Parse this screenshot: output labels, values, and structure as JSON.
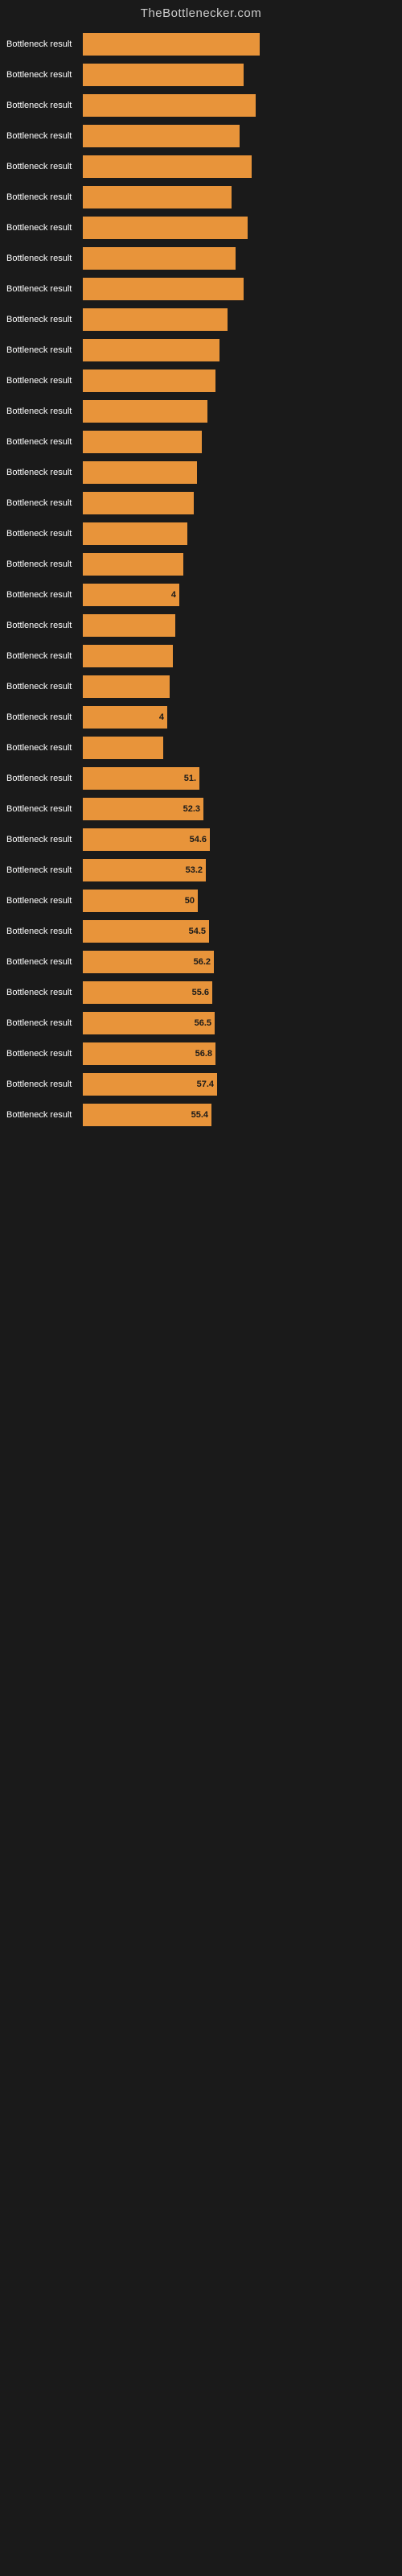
{
  "header": {
    "title": "TheBottlenecker.com"
  },
  "rows": [
    {
      "label": "Bottleneck result",
      "value": "",
      "barWidth": 220
    },
    {
      "label": "Bottleneck result",
      "value": "",
      "barWidth": 200
    },
    {
      "label": "Bottleneck result",
      "value": "",
      "barWidth": 215
    },
    {
      "label": "Bottleneck result",
      "value": "",
      "barWidth": 195
    },
    {
      "label": "Bottleneck result",
      "value": "",
      "barWidth": 210
    },
    {
      "label": "Bottleneck result",
      "value": "",
      "barWidth": 185
    },
    {
      "label": "Bottleneck result",
      "value": "",
      "barWidth": 205
    },
    {
      "label": "Bottleneck result",
      "value": "",
      "barWidth": 190
    },
    {
      "label": "Bottleneck result",
      "value": "",
      "barWidth": 200
    },
    {
      "label": "Bottleneck result",
      "value": "",
      "barWidth": 180
    },
    {
      "label": "Bottleneck result",
      "value": "",
      "barWidth": 170
    },
    {
      "label": "Bottleneck result",
      "value": "",
      "barWidth": 165
    },
    {
      "label": "Bottleneck result",
      "value": "",
      "barWidth": 155
    },
    {
      "label": "Bottleneck result",
      "value": "",
      "barWidth": 148
    },
    {
      "label": "Bottleneck result",
      "value": "",
      "barWidth": 142
    },
    {
      "label": "Bottleneck result",
      "value": "",
      "barWidth": 138
    },
    {
      "label": "Bottleneck result",
      "value": "",
      "barWidth": 130
    },
    {
      "label": "Bottleneck result",
      "value": "",
      "barWidth": 125
    },
    {
      "label": "Bottleneck result",
      "value": "4",
      "barWidth": 120
    },
    {
      "label": "Bottleneck result",
      "value": "",
      "barWidth": 115
    },
    {
      "label": "Bottleneck result",
      "value": "",
      "barWidth": 112
    },
    {
      "label": "Bottleneck result",
      "value": "",
      "barWidth": 108
    },
    {
      "label": "Bottleneck result",
      "value": "4",
      "barWidth": 105
    },
    {
      "label": "Bottleneck result",
      "value": "",
      "barWidth": 100
    },
    {
      "label": "Bottleneck result",
      "value": "51.",
      "barWidth": 145
    },
    {
      "label": "Bottleneck result",
      "value": "52.3",
      "barWidth": 150
    },
    {
      "label": "Bottleneck result",
      "value": "54.6",
      "barWidth": 158
    },
    {
      "label": "Bottleneck result",
      "value": "53.2",
      "barWidth": 153
    },
    {
      "label": "Bottleneck result",
      "value": "50",
      "barWidth": 143
    },
    {
      "label": "Bottleneck result",
      "value": "54.5",
      "barWidth": 157
    },
    {
      "label": "Bottleneck result",
      "value": "56.2",
      "barWidth": 163
    },
    {
      "label": "Bottleneck result",
      "value": "55.6",
      "barWidth": 161
    },
    {
      "label": "Bottleneck result",
      "value": "56.5",
      "barWidth": 164
    },
    {
      "label": "Bottleneck result",
      "value": "56.8",
      "barWidth": 165
    },
    {
      "label": "Bottleneck result",
      "value": "57.4",
      "barWidth": 167
    },
    {
      "label": "Bottleneck result",
      "value": "55.4",
      "barWidth": 160
    }
  ]
}
